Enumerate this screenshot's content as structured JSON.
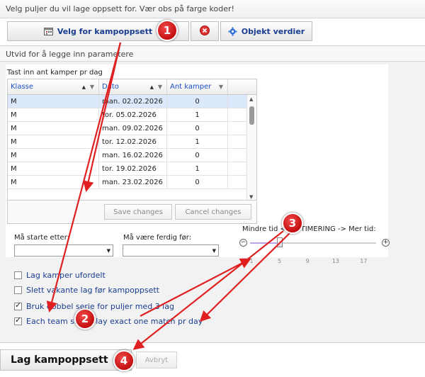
{
  "top_strip": {
    "text": "Velg puljer du vil lage oppsett for. Vær obs på farge koder!"
  },
  "toolbar": {
    "choose_label": "Velg for kampoppsett",
    "objects_label": "Objekt verdier"
  },
  "panel": {
    "header": "Utvid for å legge inn parametere",
    "grid_caption": "Tast inn ant kamper pr dag",
    "columns": [
      "Klasse",
      "Dato",
      "Ant kamper"
    ],
    "rows": [
      [
        "M",
        "man. 02.02.2026",
        "0"
      ],
      [
        "M",
        "tor. 05.02.2026",
        "1"
      ],
      [
        "M",
        "man. 09.02.2026",
        "0"
      ],
      [
        "M",
        "tor. 12.02.2026",
        "1"
      ],
      [
        "M",
        "man. 16.02.2026",
        "0"
      ],
      [
        "M",
        "tor. 19.02.2026",
        "1"
      ],
      [
        "M",
        "man. 23.02.2026",
        "0"
      ]
    ],
    "save_label": "Save changes",
    "cancel_label": "Cancel changes"
  },
  "filters": {
    "start_after_label": "Må starte etter:",
    "finish_before_label": "Må være ferdig før:",
    "start_after_value": "",
    "finish_before_value": ""
  },
  "slider": {
    "label": "Mindre tid <- OPTIMERING -> Mer tid:",
    "ticks": [
      "1",
      "5",
      "9",
      "13",
      "17"
    ],
    "value": 5
  },
  "checkboxes": [
    {
      "label": "Lag kamper ufordelt",
      "checked": false
    },
    {
      "label": "Slett vakante lag før kampoppsett",
      "checked": false
    },
    {
      "label": "Bruk dobbel serie for puljer med 3 lag",
      "checked": true
    },
    {
      "label": "Each team shall play exact one match pr day",
      "checked": true
    }
  ],
  "actions": {
    "create_label": "Lag kampoppsett",
    "abort_label": "Avbryt"
  },
  "annotations": [
    "1",
    "2",
    "3",
    "4"
  ],
  "colors": {
    "badge": "#d41414",
    "arrow": "#e02020",
    "link_text": "#1a3d8f",
    "header_text": "#1a4fc4"
  }
}
